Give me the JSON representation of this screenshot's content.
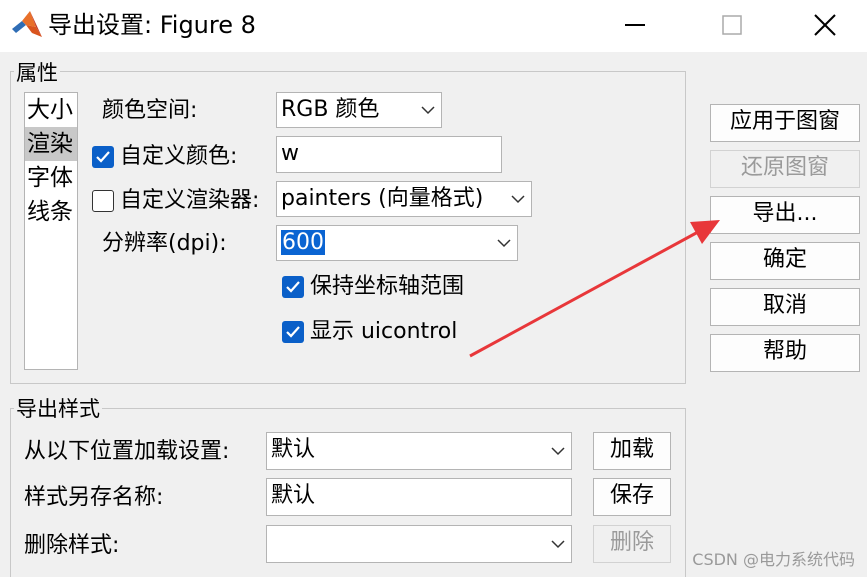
{
  "window": {
    "title": "导出设置: Figure 8"
  },
  "properties": {
    "group_label": "属性",
    "categories": [
      "大小",
      "渲染",
      "字体",
      "线条"
    ],
    "selected_category": "渲染",
    "color_space": {
      "label": "颜色空间:",
      "value": "RGB 颜色"
    },
    "custom_color": {
      "label": "自定义颜色:",
      "checked": true,
      "value": "w"
    },
    "custom_renderer": {
      "label": "自定义渲染器:",
      "checked": false,
      "value": "painters (向量格式)"
    },
    "resolution": {
      "label": "分辨率(dpi):",
      "value": "600"
    },
    "keep_axes_limits": {
      "label": "保持坐标轴范围",
      "checked": true
    },
    "show_uicontrol": {
      "label": "显示 uicontrol",
      "checked": true
    }
  },
  "export_style": {
    "group_label": "导出样式",
    "load_settings": {
      "label": "从以下位置加载设置:",
      "value": "默认",
      "button": "加载"
    },
    "save_style": {
      "label": "样式另存名称:",
      "value": "默认",
      "button": "保存"
    },
    "delete_style": {
      "label": "删除样式:",
      "value": "",
      "button": "删除"
    }
  },
  "actions": {
    "apply_to_figure": "应用于图窗",
    "restore_figure": "还原图窗",
    "export": "导出...",
    "ok": "确定",
    "cancel": "取消",
    "help": "帮助"
  },
  "watermark": "CSDN @电力系统代码",
  "colors": {
    "accent": "#0a5fc8",
    "arrow": "#e8373a",
    "selection": "#0a64d2"
  }
}
